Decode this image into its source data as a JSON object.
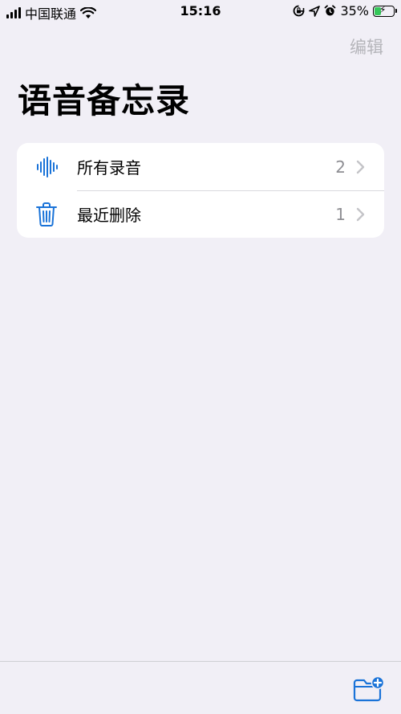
{
  "status_bar": {
    "carrier": "中国联通",
    "time": "15:16",
    "battery_percent": "35%",
    "battery_level": 0.35,
    "icons": [
      "signal-icon",
      "wifi-icon",
      "screen-rotation-lock-icon",
      "location-icon",
      "alarm-icon",
      "battery-charging-icon"
    ]
  },
  "nav": {
    "edit_label": "编辑"
  },
  "page": {
    "title": "语音备忘录"
  },
  "list": [
    {
      "label": "所有录音",
      "count": "2",
      "icon": "waveform-icon"
    },
    {
      "label": "最近删除",
      "count": "1",
      "icon": "trash-icon"
    }
  ],
  "bottom_bar": {
    "new_folder_icon": "new-folder-icon"
  },
  "colors": {
    "background": "#f1eff6",
    "accent": "#1a73d8",
    "secondary_text": "#8e8e93",
    "disabled_text": "#b5b5ba"
  }
}
